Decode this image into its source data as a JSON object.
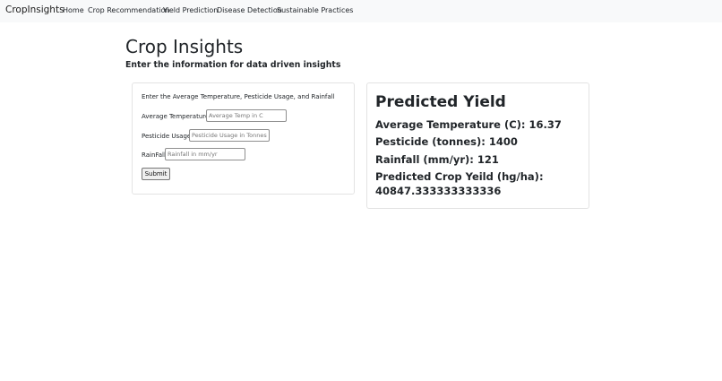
{
  "navbar": {
    "brand": "CropInsights",
    "links": [
      "Home",
      "Crop Recommendation",
      "Yield Prediction",
      "Disease Detection",
      "Sustainable Practices"
    ]
  },
  "header": {
    "title": "Crop Insights",
    "subtitle": "Enter the information for data driven insights"
  },
  "form": {
    "intro": "Enter the Average Temperature, Pesticide Usage, and Rainfall",
    "fields": [
      {
        "label": "Average Temperature",
        "placeholder": "Average Temp in C",
        "value": ""
      },
      {
        "label": "Pesticide Usage",
        "placeholder": "Pesticide Usage in Tonnes",
        "value": ""
      },
      {
        "label": "RainFall",
        "placeholder": "Rainfall in mm/yr",
        "value": ""
      }
    ],
    "submit_label": "Submit"
  },
  "result": {
    "title": "Predicted Yield",
    "lines": [
      "Average Temperature (C): 16.37",
      "Pesticide (tonnes): 1400",
      "Rainfall (mm/yr): 121",
      "Predicted Crop Yeild (hg/ha):",
      "40847.333333333336"
    ]
  }
}
